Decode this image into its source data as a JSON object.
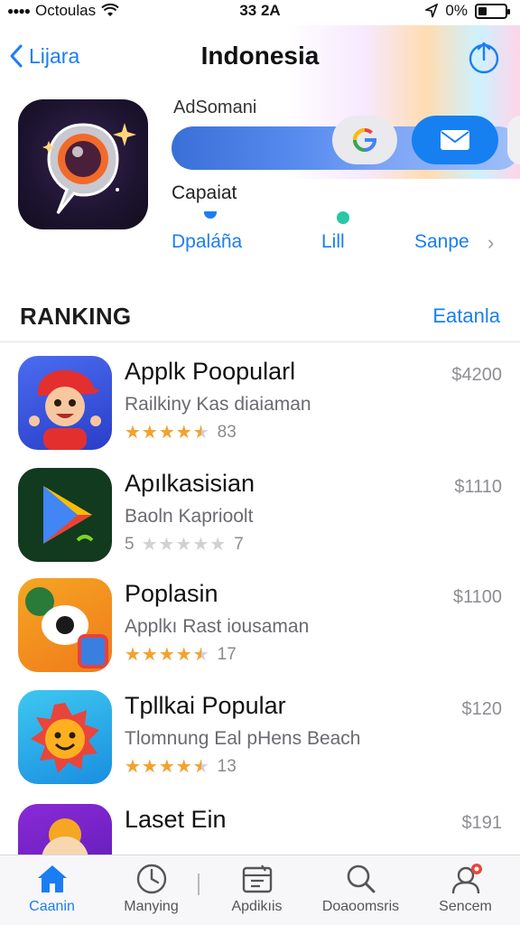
{
  "status_bar": {
    "carrier": "Octoulas",
    "time": "33 2A",
    "battery_pct": "0%"
  },
  "nav": {
    "back_label": "Lijara",
    "title": "Indonesia"
  },
  "featured": {
    "developer": "AdSomani",
    "caption": "Capaiat",
    "segments": [
      "Dpaláña",
      "Lill",
      "Sanpe"
    ]
  },
  "ranking": {
    "title": "RANKING",
    "see_all": "Eatanla",
    "items": [
      {
        "title": "Applk Poopularl",
        "subtitle": "Railkiny Kas diaiaman",
        "rating": 4.5,
        "count": "83",
        "price": "$4200"
      },
      {
        "title": "Apılkasisian",
        "subtitle": "Baoln Kaprioolt",
        "rating": 0,
        "count": "7",
        "price": "$1110",
        "rating_prefix": "5"
      },
      {
        "title": "Poplasin",
        "subtitle": "Applkı Rast iousaman",
        "rating": 4.5,
        "count": "17",
        "price": "$1100"
      },
      {
        "title": "Tpllkai Popular",
        "subtitle": "Tlomnung Eal pHens Beach",
        "rating": 4.5,
        "count": "13",
        "price": "$120"
      },
      {
        "title": "Laset Ein",
        "subtitle": "",
        "rating": 0,
        "count": "",
        "price": "$191"
      }
    ]
  },
  "tabs": [
    {
      "label": "Caanin",
      "icon": "home-icon",
      "active": true
    },
    {
      "label": "Manying",
      "icon": "clock-icon",
      "active": false
    },
    {
      "label": "Apdikıis",
      "icon": "apps-icon",
      "active": false
    },
    {
      "label": "Doaoomsris",
      "icon": "search-icon",
      "active": false
    },
    {
      "label": "Sencem",
      "icon": "account-icon",
      "active": false
    }
  ],
  "colors": {
    "accent": "#1a7ef2",
    "star": "#f2a32a",
    "mail_button": "#1680f0"
  }
}
